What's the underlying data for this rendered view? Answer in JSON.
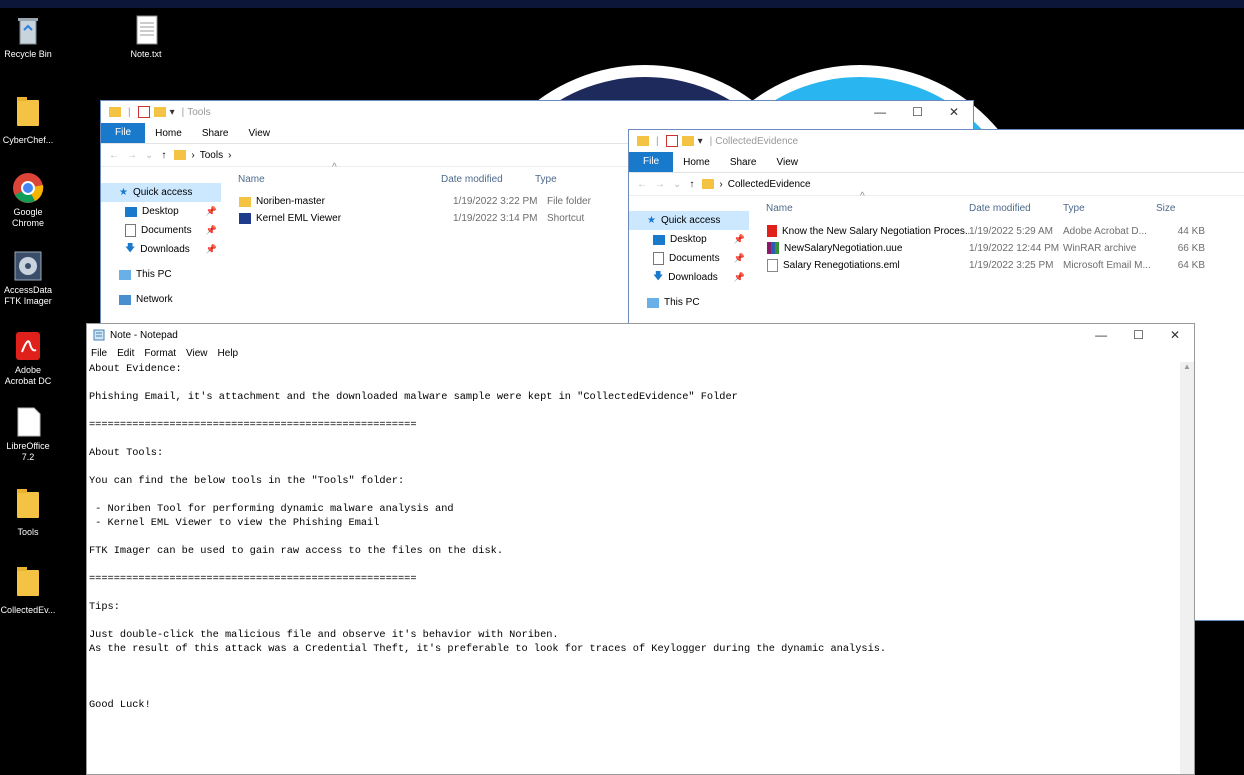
{
  "desktop": {
    "icons": [
      {
        "label": "Recycle Bin",
        "icon": "recycle-bin-icon"
      },
      {
        "label": "Note.txt",
        "icon": "text-file-icon"
      },
      {
        "label": "CyberChef...",
        "icon": "folder-icon"
      },
      {
        "label": "Google Chrome",
        "icon": "chrome-icon"
      },
      {
        "label": "AccessData FTK Imager",
        "icon": "ftk-imager-icon"
      },
      {
        "label": "Adobe Acrobat DC",
        "icon": "acrobat-icon"
      },
      {
        "label": "LibreOffice 7.2",
        "icon": "libreoffice-icon"
      },
      {
        "label": "Tools",
        "icon": "folder-icon"
      },
      {
        "label": "CollectedEv...",
        "icon": "folder-icon"
      }
    ]
  },
  "tools_window": {
    "title": "Tools",
    "ribbon": [
      "File",
      "Home",
      "Share",
      "View"
    ],
    "path": "Tools",
    "nav": [
      "Quick access",
      "Desktop",
      "Documents",
      "Downloads",
      "This PC",
      "Network"
    ],
    "columns": [
      "Name",
      "Date modified",
      "Type"
    ],
    "files": [
      {
        "name": "Noriben-master",
        "date": "1/19/2022 3:22 PM",
        "type": "File folder"
      },
      {
        "name": "Kernel EML Viewer",
        "date": "1/19/2022 3:14 PM",
        "type": "Shortcut"
      }
    ],
    "controls": [
      "—",
      "☐",
      "✕"
    ]
  },
  "evidence_window": {
    "title": "CollectedEvidence",
    "ribbon": [
      "File",
      "Home",
      "Share",
      "View"
    ],
    "path": "CollectedEvidence",
    "nav": [
      "Quick access",
      "Desktop",
      "Documents",
      "Downloads",
      "This PC"
    ],
    "columns": [
      "Name",
      "Date modified",
      "Type",
      "Size"
    ],
    "files": [
      {
        "name": "Know the New Salary Negotiation Proces...",
        "date": "1/19/2022 5:29 AM",
        "type": "Adobe Acrobat D...",
        "size": "44 KB"
      },
      {
        "name": "NewSalaryNegotiation.uue",
        "date": "1/19/2022 12:44 PM",
        "type": "WinRAR archive",
        "size": "66 KB"
      },
      {
        "name": "Salary Renegotiations.eml",
        "date": "1/19/2022 3:25 PM",
        "type": "Microsoft Email M...",
        "size": "64 KB"
      }
    ]
  },
  "notepad": {
    "title": "Note - Notepad",
    "menu": [
      "File",
      "Edit",
      "Format",
      "View",
      "Help"
    ],
    "controls": [
      "—",
      "☐",
      "✕"
    ],
    "content": "About Evidence:\n\nPhishing Email, it's attachment and the downloaded malware sample were kept in \"CollectedEvidence\" Folder\n\n=====================================================\n\nAbout Tools:\n\nYou can find the below tools in the \"Tools\" folder:\n\n - Noriben Tool for performing dynamic malware analysis and\n - Kernel EML Viewer to view the Phishing Email\n\nFTK Imager can be used to gain raw access to the files on the disk.\n\n=====================================================\n\nTips:\n\nJust double-click the malicious file and observe it's behavior with Noriben.\nAs the result of this attack was a Credential Theft, it's preferable to look for traces of Keylogger during the dynamic analysis.\n\n\n\nGood Luck!"
  },
  "colors": {
    "accent": "#1979ca",
    "wallpaper_dark": "#1e2a5c",
    "wallpaper_light": "#29b6f0"
  }
}
